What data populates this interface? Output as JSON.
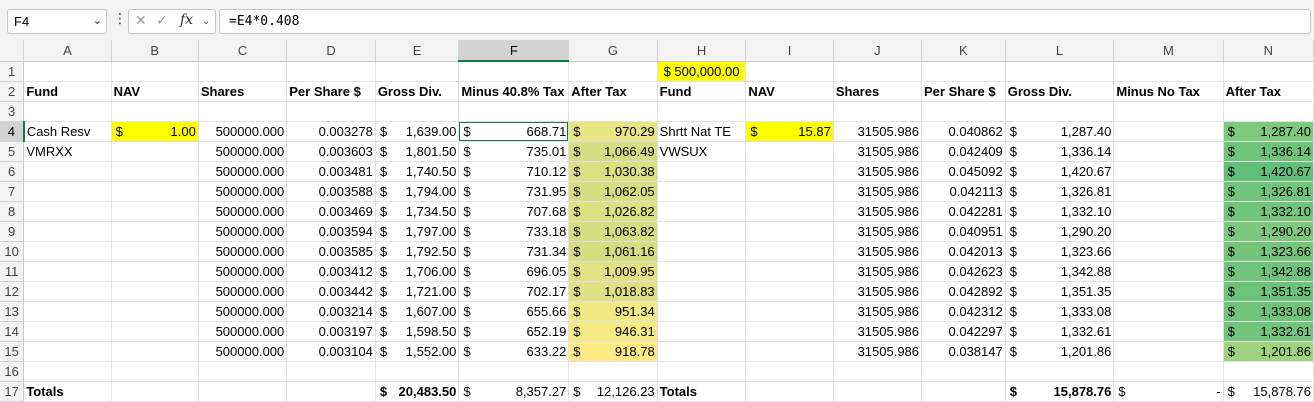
{
  "formula_bar": {
    "name_box": "F4",
    "formula": "=E4*0.408"
  },
  "columns": [
    "A",
    "B",
    "C",
    "D",
    "E",
    "F",
    "G",
    "H",
    "I",
    "J",
    "K",
    "L",
    "M",
    "N"
  ],
  "selected_column": "F",
  "selected_row": 4,
  "colors": {
    "highlight_yellow": "#ffff00",
    "selection_green": "#107c41",
    "scale_g_light": "#ffeb84",
    "scale_g_mid": "#f1e886",
    "scale_g_dark": "#d8e082",
    "scale_n_dark": "#63be7b",
    "scale_n_light": "#9ed37f"
  },
  "rows": [
    {
      "n": "1",
      "cells": [
        {
          "col": "H",
          "text": "$ 500,000.00",
          "style": "yel c"
        }
      ]
    },
    {
      "n": "2",
      "cells": [
        {
          "col": "A",
          "text": "Fund",
          "style": "b"
        },
        {
          "col": "B",
          "text": "NAV",
          "style": "b"
        },
        {
          "col": "C",
          "text": "Shares",
          "style": "b"
        },
        {
          "col": "D",
          "text": "Per Share $",
          "style": "b"
        },
        {
          "col": "E",
          "text": "Gross Div.",
          "style": "b"
        },
        {
          "col": "F",
          "text": "Minus 40.8% Tax",
          "style": "b"
        },
        {
          "col": "G",
          "text": "After Tax",
          "style": "b"
        },
        {
          "col": "H",
          "text": "Fund",
          "style": "b"
        },
        {
          "col": "I",
          "text": "NAV",
          "style": "b"
        },
        {
          "col": "J",
          "text": "Shares",
          "style": "b"
        },
        {
          "col": "K",
          "text": "Per Share $",
          "style": "b"
        },
        {
          "col": "L",
          "text": "Gross Div.",
          "style": "b"
        },
        {
          "col": "M",
          "text": "Minus No Tax",
          "style": "b"
        },
        {
          "col": "N",
          "text": "After Tax",
          "style": "b"
        }
      ]
    },
    {
      "n": "3",
      "cells": []
    },
    {
      "n": "4",
      "cells": [
        {
          "col": "A",
          "text": "Cash Resv"
        },
        {
          "col": "B",
          "sym": "$",
          "text": "1.00",
          "style": "yel"
        },
        {
          "col": "C",
          "text": "500000.000",
          "style": "r"
        },
        {
          "col": "D",
          "text": "0.003278",
          "style": "r"
        },
        {
          "col": "E",
          "sym": "$",
          "text": "1,639.00"
        },
        {
          "col": "F",
          "sym": "$",
          "text": "668.71",
          "style": "cur"
        },
        {
          "col": "G",
          "sym": "$",
          "text": "970.29",
          "bg": "#e8e585"
        },
        {
          "col": "H",
          "text": "Shrtt Nat TE"
        },
        {
          "col": "I",
          "sym": "$",
          "text": "15.87",
          "style": "yel"
        },
        {
          "col": "J",
          "text": "31505.986",
          "style": "r"
        },
        {
          "col": "K",
          "text": "0.040862",
          "style": "r"
        },
        {
          "col": "L",
          "sym": "$",
          "text": "1,287.40"
        },
        {
          "col": "N",
          "sym": "$",
          "text": "1,287.40",
          "bg": "#7fc97d"
        }
      ]
    },
    {
      "n": "5",
      "cells": [
        {
          "col": "A",
          "text": "VMRXX"
        },
        {
          "col": "C",
          "text": "500000.000",
          "style": "r"
        },
        {
          "col": "D",
          "text": "0.003603",
          "style": "r"
        },
        {
          "col": "E",
          "sym": "$",
          "text": "1,801.50"
        },
        {
          "col": "F",
          "sym": "$",
          "text": "735.01"
        },
        {
          "col": "G",
          "sym": "$",
          "text": "1,066.49",
          "bg": "#d3df82"
        },
        {
          "col": "H",
          "text": "VWSUX"
        },
        {
          "col": "J",
          "text": "31505.986",
          "style": "r"
        },
        {
          "col": "K",
          "text": "0.042409",
          "style": "r"
        },
        {
          "col": "L",
          "sym": "$",
          "text": "1,336.14"
        },
        {
          "col": "N",
          "sym": "$",
          "text": "1,336.14",
          "bg": "#70c37c"
        }
      ]
    },
    {
      "n": "6",
      "cells": [
        {
          "col": "C",
          "text": "500000.000",
          "style": "r"
        },
        {
          "col": "D",
          "text": "0.003481",
          "style": "r"
        },
        {
          "col": "E",
          "sym": "$",
          "text": "1,740.50"
        },
        {
          "col": "F",
          "sym": "$",
          "text": "710.12"
        },
        {
          "col": "G",
          "sym": "$",
          "text": "1,030.38",
          "bg": "#dbe183"
        },
        {
          "col": "J",
          "text": "31505.986",
          "style": "r"
        },
        {
          "col": "K",
          "text": "0.045092",
          "style": "r"
        },
        {
          "col": "L",
          "sym": "$",
          "text": "1,420.67"
        },
        {
          "col": "N",
          "sym": "$",
          "text": "1,420.67",
          "bg": "#63be7b"
        }
      ]
    },
    {
      "n": "7",
      "cells": [
        {
          "col": "C",
          "text": "500000.000",
          "style": "r"
        },
        {
          "col": "D",
          "text": "0.003588",
          "style": "r"
        },
        {
          "col": "E",
          "sym": "$",
          "text": "1,794.00"
        },
        {
          "col": "F",
          "sym": "$",
          "text": "731.95"
        },
        {
          "col": "G",
          "sym": "$",
          "text": "1,062.05",
          "bg": "#d4df82"
        },
        {
          "col": "J",
          "text": "31505.986",
          "style": "r"
        },
        {
          "col": "K",
          "text": "0.042113",
          "style": "r"
        },
        {
          "col": "L",
          "sym": "$",
          "text": "1,326.81"
        },
        {
          "col": "N",
          "sym": "$",
          "text": "1,326.81",
          "bg": "#73c47c"
        }
      ]
    },
    {
      "n": "8",
      "cells": [
        {
          "col": "C",
          "text": "500000.000",
          "style": "r"
        },
        {
          "col": "D",
          "text": "0.003469",
          "style": "r"
        },
        {
          "col": "E",
          "sym": "$",
          "text": "1,734.50"
        },
        {
          "col": "F",
          "sym": "$",
          "text": "707.68"
        },
        {
          "col": "G",
          "sym": "$",
          "text": "1,026.82",
          "bg": "#dce184"
        },
        {
          "col": "J",
          "text": "31505.986",
          "style": "r"
        },
        {
          "col": "K",
          "text": "0.042281",
          "style": "r"
        },
        {
          "col": "L",
          "sym": "$",
          "text": "1,332.10"
        },
        {
          "col": "N",
          "sym": "$",
          "text": "1,332.10",
          "bg": "#72c47c"
        }
      ]
    },
    {
      "n": "9",
      "cells": [
        {
          "col": "C",
          "text": "500000.000",
          "style": "r"
        },
        {
          "col": "D",
          "text": "0.003594",
          "style": "r"
        },
        {
          "col": "E",
          "sym": "$",
          "text": "1,797.00"
        },
        {
          "col": "F",
          "sym": "$",
          "text": "733.18"
        },
        {
          "col": "G",
          "sym": "$",
          "text": "1,063.82",
          "bg": "#d4df82"
        },
        {
          "col": "J",
          "text": "31505.986",
          "style": "r"
        },
        {
          "col": "K",
          "text": "0.040951",
          "style": "r"
        },
        {
          "col": "L",
          "sym": "$",
          "text": "1,290.20"
        },
        {
          "col": "N",
          "sym": "$",
          "text": "1,290.20",
          "bg": "#7ec87d"
        }
      ]
    },
    {
      "n": "10",
      "cells": [
        {
          "col": "C",
          "text": "500000.000",
          "style": "r"
        },
        {
          "col": "D",
          "text": "0.003585",
          "style": "r"
        },
        {
          "col": "E",
          "sym": "$",
          "text": "1,792.50"
        },
        {
          "col": "F",
          "sym": "$",
          "text": "731.34"
        },
        {
          "col": "G",
          "sym": "$",
          "text": "1,061.16",
          "bg": "#d5df82"
        },
        {
          "col": "J",
          "text": "31505.986",
          "style": "r"
        },
        {
          "col": "K",
          "text": "0.042013",
          "style": "r"
        },
        {
          "col": "L",
          "sym": "$",
          "text": "1,323.66"
        },
        {
          "col": "N",
          "sym": "$",
          "text": "1,323.66",
          "bg": "#74c47c"
        }
      ]
    },
    {
      "n": "11",
      "cells": [
        {
          "col": "C",
          "text": "500000.000",
          "style": "r"
        },
        {
          "col": "D",
          "text": "0.003412",
          "style": "r"
        },
        {
          "col": "E",
          "sym": "$",
          "text": "1,706.00"
        },
        {
          "col": "F",
          "sym": "$",
          "text": "696.05"
        },
        {
          "col": "G",
          "sym": "$",
          "text": "1,009.95",
          "bg": "#e0e284"
        },
        {
          "col": "J",
          "text": "31505.986",
          "style": "r"
        },
        {
          "col": "K",
          "text": "0.042623",
          "style": "r"
        },
        {
          "col": "L",
          "sym": "$",
          "text": "1,342.88"
        },
        {
          "col": "N",
          "sym": "$",
          "text": "1,342.88",
          "bg": "#6fc37c"
        }
      ]
    },
    {
      "n": "12",
      "cells": [
        {
          "col": "C",
          "text": "500000.000",
          "style": "r"
        },
        {
          "col": "D",
          "text": "0.003442",
          "style": "r"
        },
        {
          "col": "E",
          "sym": "$",
          "text": "1,721.00"
        },
        {
          "col": "F",
          "sym": "$",
          "text": "702.17"
        },
        {
          "col": "G",
          "sym": "$",
          "text": "1,018.83",
          "bg": "#dee284"
        },
        {
          "col": "J",
          "text": "31505.986",
          "style": "r"
        },
        {
          "col": "K",
          "text": "0.042892",
          "style": "r"
        },
        {
          "col": "L",
          "sym": "$",
          "text": "1,351.35"
        },
        {
          "col": "N",
          "sym": "$",
          "text": "1,351.35",
          "bg": "#6dc27c"
        }
      ]
    },
    {
      "n": "13",
      "cells": [
        {
          "col": "C",
          "text": "500000.000",
          "style": "r"
        },
        {
          "col": "D",
          "text": "0.003214",
          "style": "r"
        },
        {
          "col": "E",
          "sym": "$",
          "text": "1,607.00"
        },
        {
          "col": "F",
          "sym": "$",
          "text": "655.66"
        },
        {
          "col": "G",
          "sym": "$",
          "text": "951.34",
          "bg": "#f3e985"
        },
        {
          "col": "J",
          "text": "31505.986",
          "style": "r"
        },
        {
          "col": "K",
          "text": "0.042312",
          "style": "r"
        },
        {
          "col": "L",
          "sym": "$",
          "text": "1,333.08"
        },
        {
          "col": "N",
          "sym": "$",
          "text": "1,333.08",
          "bg": "#71c37c"
        }
      ]
    },
    {
      "n": "14",
      "cells": [
        {
          "col": "C",
          "text": "500000.000",
          "style": "r"
        },
        {
          "col": "D",
          "text": "0.003197",
          "style": "r"
        },
        {
          "col": "E",
          "sym": "$",
          "text": "1,598.50"
        },
        {
          "col": "F",
          "sym": "$",
          "text": "652.19"
        },
        {
          "col": "G",
          "sym": "$",
          "text": "946.31",
          "bg": "#f6ea85"
        },
        {
          "col": "J",
          "text": "31505.986",
          "style": "r"
        },
        {
          "col": "K",
          "text": "0.042297",
          "style": "r"
        },
        {
          "col": "L",
          "sym": "$",
          "text": "1,332.61"
        },
        {
          "col": "N",
          "sym": "$",
          "text": "1,332.61",
          "bg": "#72c47c"
        }
      ]
    },
    {
      "n": "15",
      "cells": [
        {
          "col": "C",
          "text": "500000.000",
          "style": "r"
        },
        {
          "col": "D",
          "text": "0.003104",
          "style": "r"
        },
        {
          "col": "E",
          "sym": "$",
          "text": "1,552.00"
        },
        {
          "col": "F",
          "sym": "$",
          "text": "633.22"
        },
        {
          "col": "G",
          "sym": "$",
          "text": "918.78",
          "bg": "#ffeb84"
        },
        {
          "col": "J",
          "text": "31505.986",
          "style": "r"
        },
        {
          "col": "K",
          "text": "0.038147",
          "style": "r"
        },
        {
          "col": "L",
          "sym": "$",
          "text": "1,201.86"
        },
        {
          "col": "N",
          "sym": "$",
          "text": "1,201.86",
          "bg": "#9ed37f"
        }
      ]
    },
    {
      "n": "16",
      "cells": []
    },
    {
      "n": "17",
      "cells": [
        {
          "col": "A",
          "text": "Totals",
          "style": "b"
        },
        {
          "col": "E",
          "sym": "$",
          "text": "20,483.50",
          "style": "b"
        },
        {
          "col": "F",
          "sym": "$",
          "text": "8,357.27"
        },
        {
          "col": "G",
          "sym": "$",
          "text": "12,126.23"
        },
        {
          "col": "H",
          "text": "Totals",
          "style": "b"
        },
        {
          "col": "L",
          "sym": "$",
          "text": "15,878.76",
          "style": "b"
        },
        {
          "col": "M",
          "sym": "$",
          "text": "-"
        },
        {
          "col": "N",
          "sym": "$",
          "text": "15,878.76"
        }
      ]
    }
  ]
}
